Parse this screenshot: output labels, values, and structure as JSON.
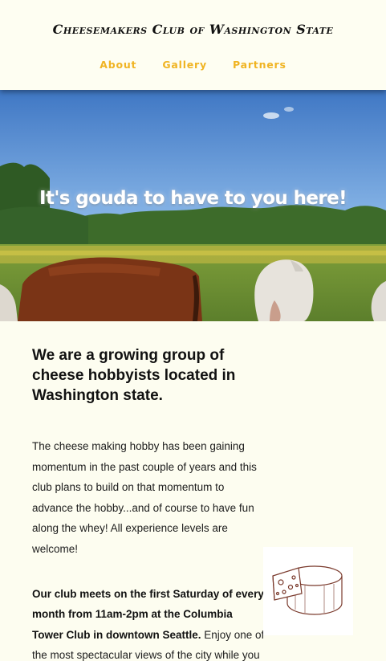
{
  "header": {
    "title": "Cheesemakers Club of Washington State",
    "nav": [
      "About",
      "Gallery",
      "Partners"
    ]
  },
  "hero": {
    "headline": "It's gouda to have to you here!"
  },
  "main": {
    "heading": "We are a growing group of cheese hobbyists located in Washington state.",
    "paragraph1": "The cheese making hobby has been gaining momentum in the past couple of years and this club plans to build on that momentum to advance the hobby...and of course to have fun along the whey! All experience levels are welcome!",
    "paragraph2_bold": "Our club meets on the first Saturday of every month from 11am-2pm at the Columbia Tower Club in downtown Seattle.",
    "paragraph2_rest": " Enjoy one of the most spectacular views of the city while you"
  },
  "colors": {
    "background": "#fdfdf0",
    "nav_accent": "#f0b423"
  },
  "icons": {
    "cheese": "cheese-wheel-illustration"
  }
}
